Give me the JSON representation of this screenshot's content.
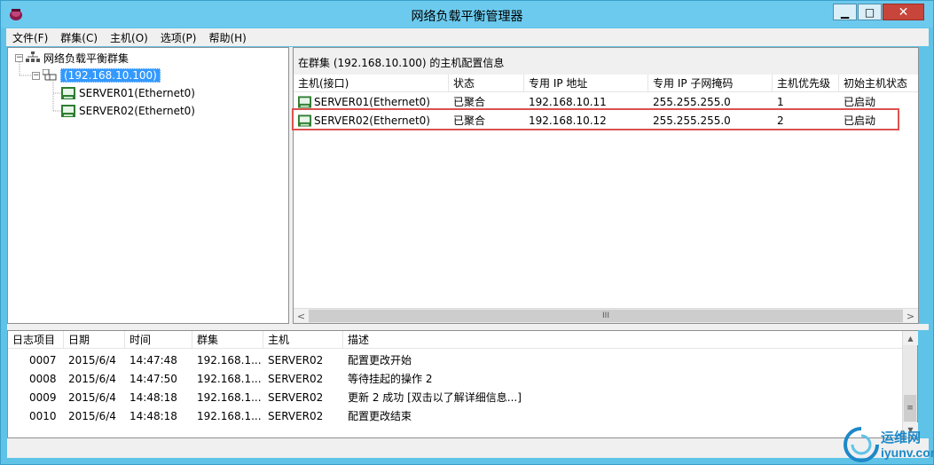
{
  "window": {
    "title": "网络负载平衡管理器",
    "min_glyph": "▁",
    "max_glyph": "□",
    "close_glyph": "✕"
  },
  "menu": [
    "文件(F)",
    "群集(C)",
    "主机(O)",
    "选项(P)",
    "帮助(H)"
  ],
  "tree": {
    "root": {
      "label": "网络负载平衡群集",
      "expander": "−",
      "icon": "cluster-network-icon"
    },
    "cluster": {
      "label": "(192.168.10.100)",
      "expander": "−",
      "icon": "cluster-icon"
    },
    "hosts": [
      {
        "label": "SERVER01(Ethernet0)",
        "icon": "host-converged-icon"
      },
      {
        "label": "SERVER02(Ethernet0)",
        "icon": "host-converged-icon"
      }
    ]
  },
  "detail": {
    "header": "在群集 (192.168.10.100) 的主机配置信息",
    "columns": [
      "主机(接口)",
      "状态",
      "专用 IP 地址",
      "专用 IP 子网掩码",
      "主机优先级",
      "初始主机状态"
    ],
    "rows": [
      {
        "host": "SERVER01(Ethernet0)",
        "status": "已聚合",
        "ip": "192.168.10.11",
        "mask": "255.255.255.0",
        "priority": "1",
        "initial_state": "已启动"
      },
      {
        "host": "SERVER02(Ethernet0)",
        "status": "已聚合",
        "ip": "192.168.10.12",
        "mask": "255.255.255.0",
        "priority": "2",
        "initial_state": "已启动"
      }
    ],
    "highlighted_row": 1,
    "scroll_left": "<",
    "scroll_right": ">",
    "scroll_grip": "III"
  },
  "log": {
    "columns": [
      "日志项目",
      "日期",
      "时间",
      "群集",
      "主机",
      "描述"
    ],
    "rows": [
      {
        "id": "0007",
        "date": "2015/6/4",
        "time": "14:47:48",
        "cluster": "192.168.1...",
        "host": "SERVER02",
        "desc": "配置更改开始"
      },
      {
        "id": "0008",
        "date": "2015/6/4",
        "time": "14:47:50",
        "cluster": "192.168.1...",
        "host": "SERVER02",
        "desc": "等待挂起的操作 2"
      },
      {
        "id": "0009",
        "date": "2015/6/4",
        "time": "14:48:18",
        "cluster": "192.168.1...",
        "host": "SERVER02",
        "desc": "更新 2 成功 [双击以了解详细信息...]"
      },
      {
        "id": "0010",
        "date": "2015/6/4",
        "time": "14:48:18",
        "cluster": "192.168.1...",
        "host": "SERVER02",
        "desc": "配置更改结束"
      }
    ],
    "scroll_up": "▲",
    "scroll_down": "▼",
    "scroll_grip": "≡"
  },
  "watermark": {
    "name": "运维网",
    "url": "iyunv.com"
  },
  "colors": {
    "titlebar": "#6ccaee",
    "selection": "#3399ff",
    "highlight_border": "#d9534f",
    "close_button": "#c7453a"
  }
}
